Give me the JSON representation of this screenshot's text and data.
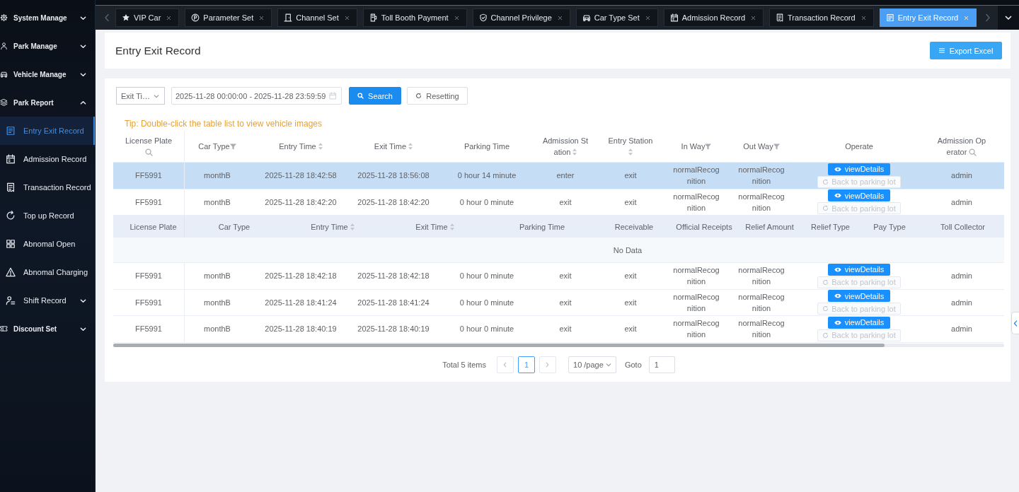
{
  "sidebar": {
    "items": [
      {
        "label": "System Manage",
        "selected": false,
        "expanded": false
      },
      {
        "label": "Park Manage",
        "selected": false,
        "expanded": false
      },
      {
        "label": "Vehicle Manage",
        "selected": false,
        "expanded": false
      },
      {
        "label": "Park Report",
        "selected": false,
        "expanded": true,
        "children": [
          {
            "label": "Entry Exit Record",
            "selected": true
          },
          {
            "label": "Admission Record",
            "selected": false
          },
          {
            "label": "Transaction Record",
            "selected": false
          },
          {
            "label": "Top up Record",
            "selected": false
          },
          {
            "label": "Abnomal Open",
            "selected": false
          },
          {
            "label": "Abnomal Charging",
            "selected": false
          },
          {
            "label": "Shift Record",
            "selected": false,
            "expanded": false
          }
        ]
      },
      {
        "label": "Discount Set",
        "selected": false,
        "expanded": false
      }
    ]
  },
  "tabs": [
    {
      "label": "VIP Car",
      "selected": false
    },
    {
      "label": "Parameter Set",
      "selected": false
    },
    {
      "label": "Channel Set",
      "selected": false
    },
    {
      "label": "Toll Booth Payment",
      "selected": false
    },
    {
      "label": "Channel Privilege",
      "selected": false
    },
    {
      "label": "Car Type Set",
      "selected": false
    },
    {
      "label": "Admission Record",
      "selected": false
    },
    {
      "label": "Transaction Record",
      "selected": false
    },
    {
      "label": "Entry Exit Record",
      "selected": true
    }
  ],
  "page_header": {
    "title": "Entry Exit Record",
    "export_button": "Export Excel"
  },
  "filters": {
    "time_field": {
      "value": "Exit Ti…"
    },
    "date_range": {
      "value": "2025-11-28 00:00:00 - 2025-11-28 23:59:59"
    },
    "search_button": "Search",
    "reset_button": "Resetting"
  },
  "tip": "Tip: Double-click the table list to view vehicle images",
  "table": {
    "columns": [
      {
        "label": "License Plate",
        "kind": "search"
      },
      {
        "label": "Car Type",
        "kind": "filter"
      },
      {
        "label": "Entry Time",
        "kind": "sort"
      },
      {
        "label": "Exit Time",
        "kind": "sort"
      },
      {
        "label": "Parking Time",
        "kind": "plain"
      },
      {
        "label": "Admission Station",
        "kind": "sort"
      },
      {
        "label": "Entry Station",
        "kind": "sort"
      },
      {
        "label": "In Way",
        "kind": "filter"
      },
      {
        "label": "Out Way",
        "kind": "filter"
      },
      {
        "label": "Operate",
        "kind": "plain"
      },
      {
        "label": "Admission Operator",
        "kind": "search"
      }
    ],
    "rows": [
      {
        "selected": true,
        "cells": [
          "FF5991",
          "monthB",
          "2025-11-28 18:42:58",
          "2025-11-28 18:56:08",
          "0 hour 14 minute",
          "enter",
          "exit",
          "normalRecognition",
          "normalRecognition"
        ],
        "view_button": "viewDetails",
        "back_button": {
          "label": "Back to parking lot",
          "disabled": true
        },
        "operator": "admin"
      },
      {
        "selected": false,
        "cells": [
          "FF5991",
          "monthB",
          "2025-11-28 18:42:20",
          "2025-11-28 18:42:20",
          "0 hour 0 minute",
          "exit",
          "exit",
          "normalRecognition",
          "normalRecognition"
        ],
        "view_button": "viewDetails",
        "back_button": {
          "label": "Back to parking lot",
          "disabled": true
        },
        "operator": "admin",
        "detail": {
          "columns": [
            {
              "label": "License Plate",
              "kind": "plain"
            },
            {
              "label": "Car Type",
              "kind": "plain"
            },
            {
              "label": "Entry Time",
              "kind": "sort"
            },
            {
              "label": "Exit Time",
              "kind": "sort"
            },
            {
              "label": "Parking Time",
              "kind": "plain"
            },
            {
              "label": "Receivable",
              "kind": "plain"
            },
            {
              "label": "Official Receipts",
              "kind": "plain"
            },
            {
              "label": "Relief Amount",
              "kind": "plain"
            },
            {
              "label": "Relief Type",
              "kind": "plain"
            },
            {
              "label": "Pay Type",
              "kind": "plain"
            },
            {
              "label": "Toll Collector",
              "kind": "plain"
            }
          ],
          "empty_text": "No Data"
        }
      },
      {
        "selected": false,
        "cells": [
          "FF5991",
          "monthB",
          "2025-11-28 18:42:18",
          "2025-11-28 18:42:18",
          "0 hour 0 minute",
          "exit",
          "exit",
          "normalRecognition",
          "normalRecognition"
        ],
        "view_button": "viewDetails",
        "back_button": {
          "label": "Back to parking lot",
          "disabled": true
        },
        "operator": "admin"
      },
      {
        "selected": false,
        "cells": [
          "FF5991",
          "monthB",
          "2025-11-28 18:41:24",
          "2025-11-28 18:41:24",
          "0 hour 0 minute",
          "exit",
          "exit",
          "normalRecognition",
          "normalRecognition"
        ],
        "view_button": "viewDetails",
        "back_button": {
          "label": "Back to parking lot",
          "disabled": true
        },
        "operator": "admin"
      },
      {
        "selected": false,
        "cells": [
          "FF5991",
          "monthB",
          "2025-11-28 18:40:19",
          "2025-11-28 18:40:19",
          "0 hour 0 minute",
          "exit",
          "exit",
          "normalRecognition",
          "normalRecognition"
        ],
        "view_button": "viewDetails",
        "back_button": {
          "label": "Back to parking lot",
          "disabled": true
        },
        "operator": "admin"
      }
    ]
  },
  "pagination": {
    "total": "Total 5 items",
    "prev_button": {
      "disabled": true
    },
    "pages": [
      {
        "label": "1",
        "selected": true
      }
    ],
    "next_button": {
      "disabled": true
    },
    "page_size": "10 /page",
    "goto_label": "Goto",
    "goto_value": "1"
  }
}
